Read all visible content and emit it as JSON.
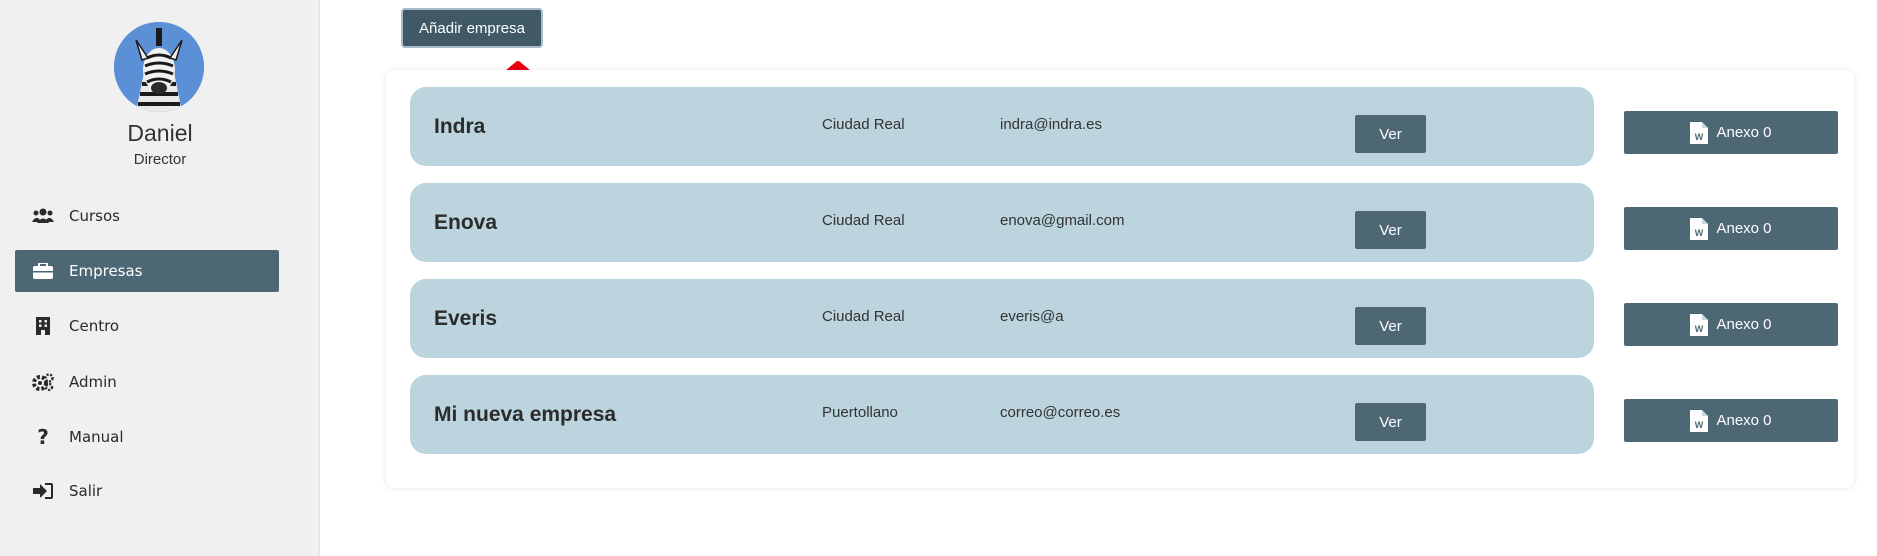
{
  "sidebar": {
    "user": {
      "name": "Daniel",
      "role": "Director"
    },
    "items": [
      {
        "label": "Cursos",
        "icon": "users-icon",
        "active": false
      },
      {
        "label": "Empresas",
        "icon": "briefcase-icon",
        "active": true
      },
      {
        "label": "Centro",
        "icon": "building-icon",
        "active": false
      },
      {
        "label": "Admin",
        "icon": "gears-icon",
        "active": false
      },
      {
        "label": "Manual",
        "icon": "question-icon",
        "active": false
      },
      {
        "label": "Salir",
        "icon": "sign-out-icon",
        "active": false
      }
    ]
  },
  "main": {
    "add_button_label": "Añadir empresa",
    "companies": [
      {
        "name": "Indra",
        "city": "Ciudad Real",
        "email": "indra@indra.es",
        "view_label": "Ver",
        "annex_label": "Anexo 0"
      },
      {
        "name": "Enova",
        "city": "Ciudad Real",
        "email": "enova@gmail.com",
        "view_label": "Ver",
        "annex_label": "Anexo 0"
      },
      {
        "name": "Everis",
        "city": "Ciudad Real",
        "email": "everis@a",
        "view_label": "Ver",
        "annex_label": "Anexo 0"
      },
      {
        "name": "Mi nueva empresa",
        "city": "Puertollano",
        "email": "correo@correo.es",
        "view_label": "Ver",
        "annex_label": "Anexo 0"
      }
    ]
  },
  "colors": {
    "primary": "#4d6775",
    "row_background": "#bcd4de",
    "sidebar_background": "#f0f0f0",
    "annotation_arrow": "#e8000f"
  }
}
